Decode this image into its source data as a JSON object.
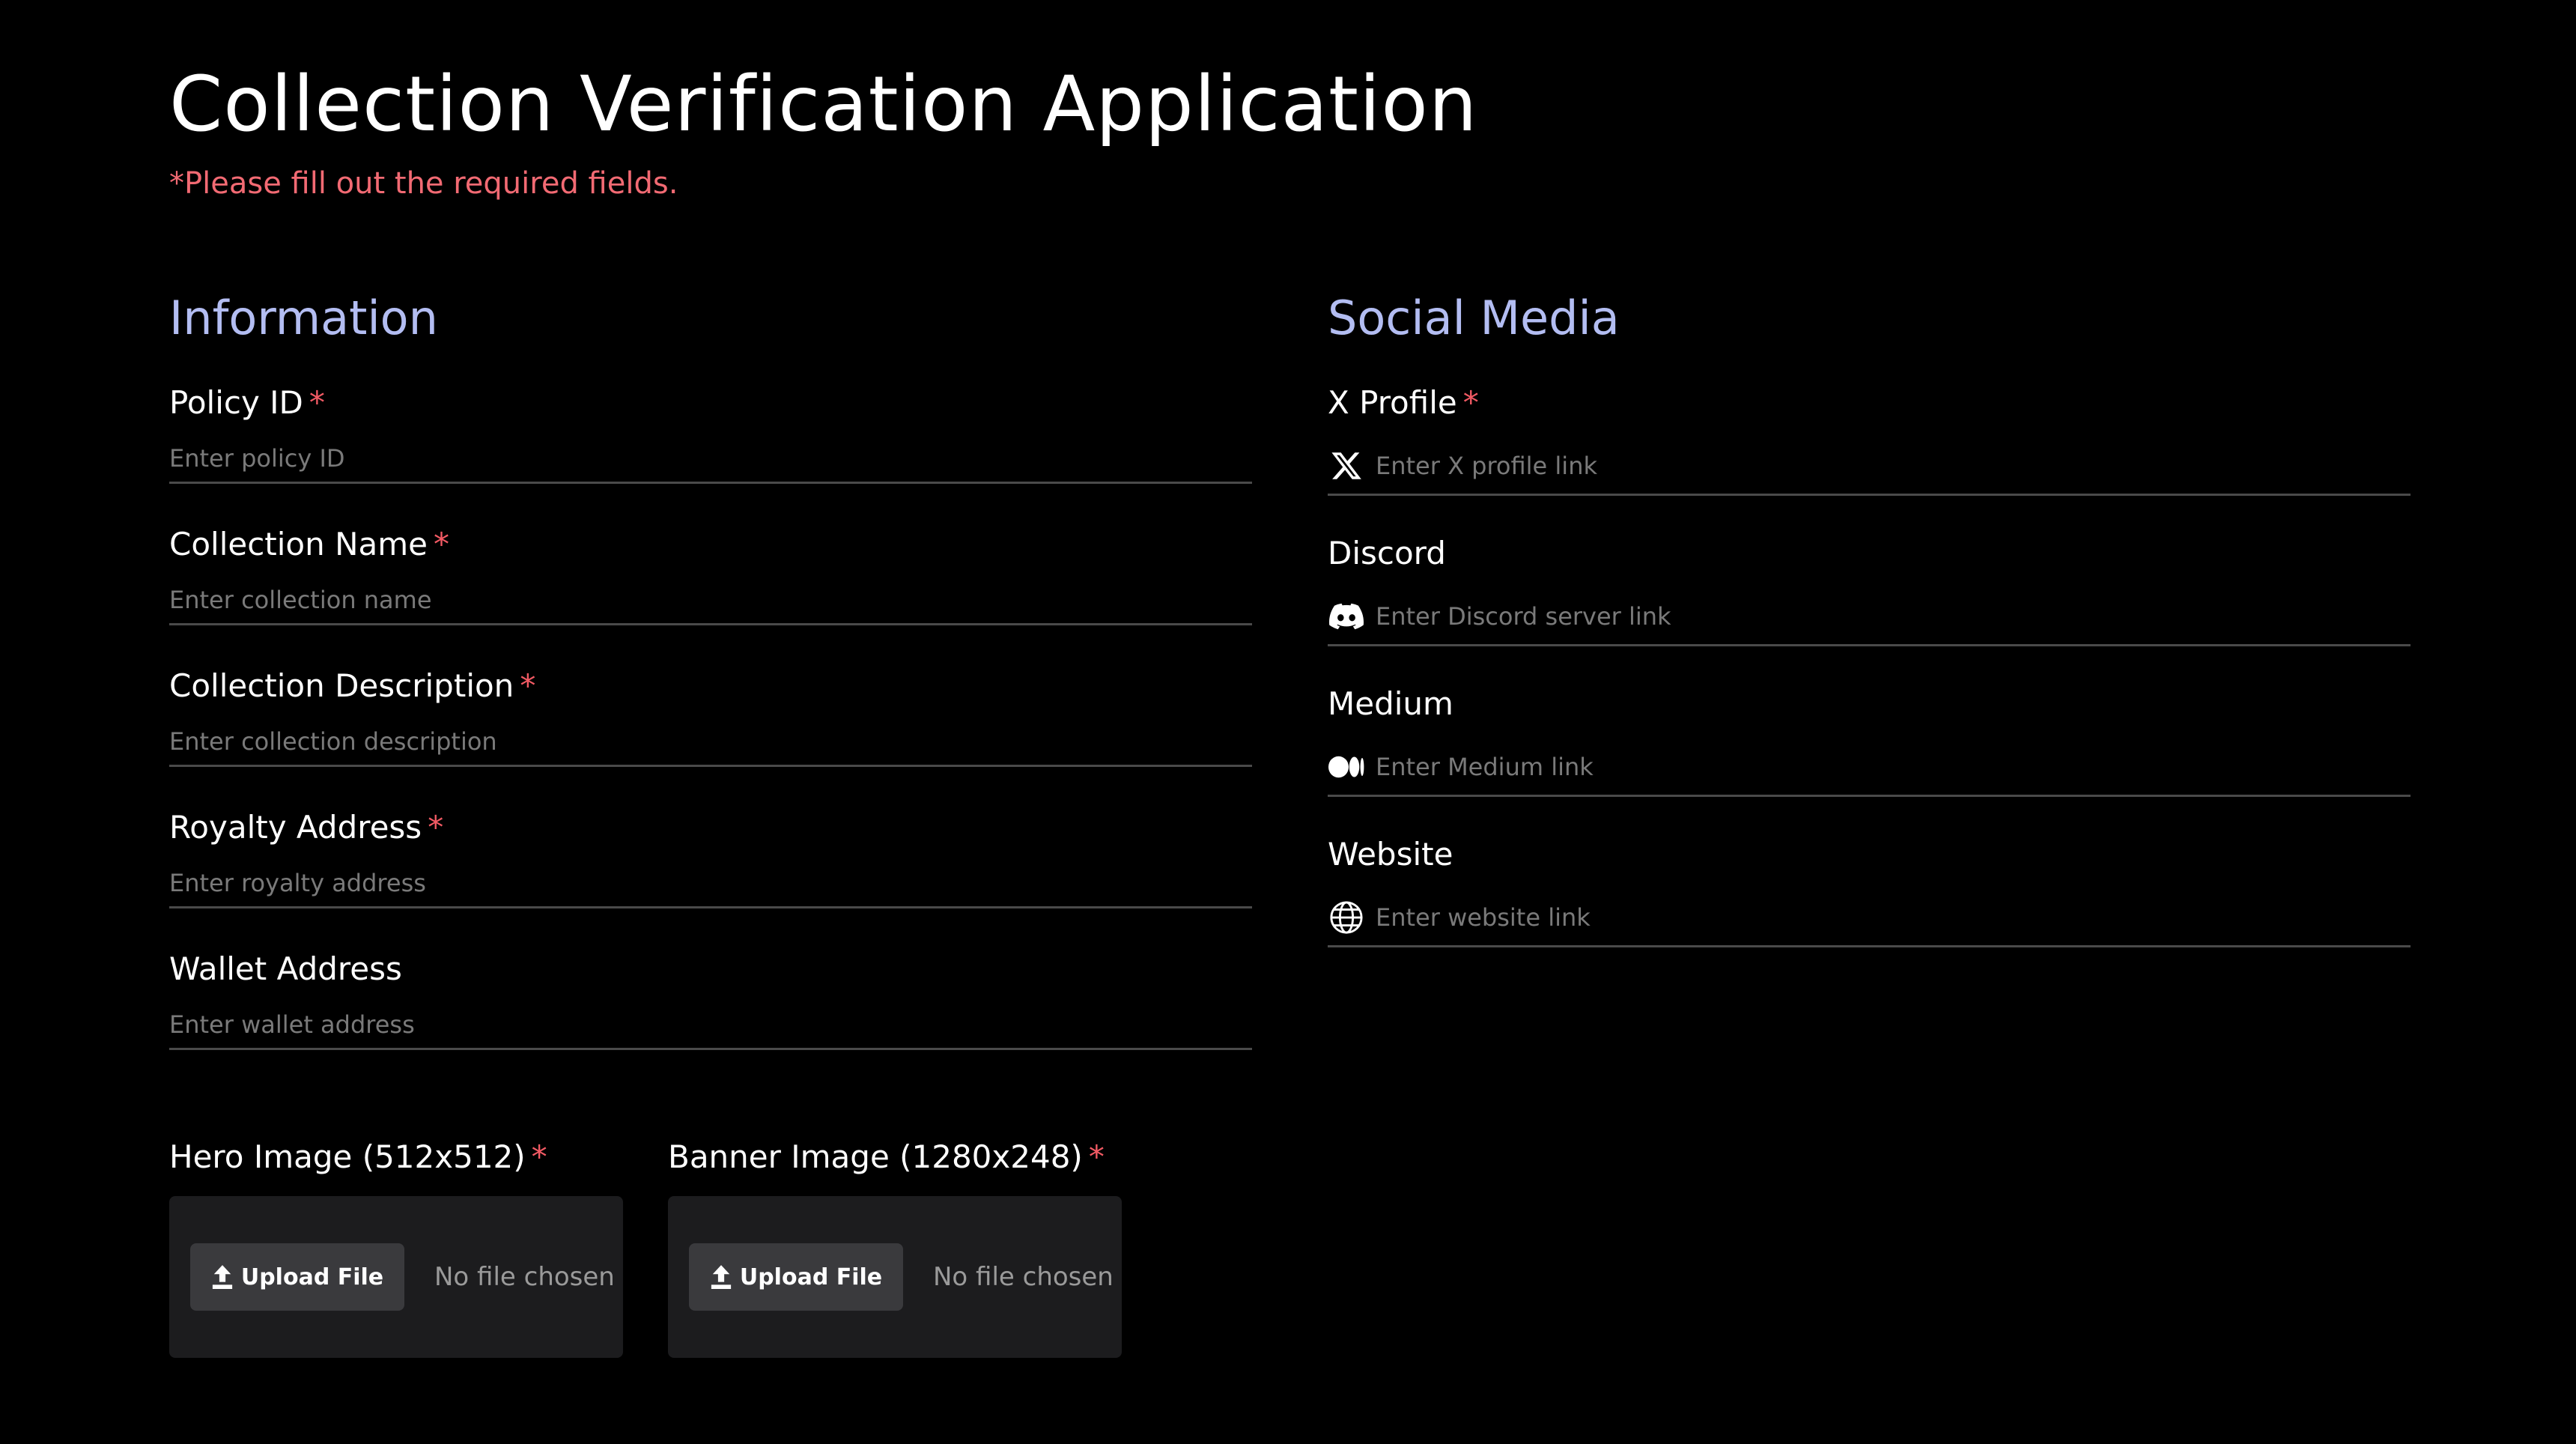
{
  "page": {
    "title": "Collection Verification Application",
    "required_note": "*Please fill out the required fields."
  },
  "information": {
    "heading": "Information",
    "fields": [
      {
        "label": "Policy ID",
        "required": "*",
        "placeholder": "Enter policy ID",
        "value": ""
      },
      {
        "label": "Collection Name",
        "required": "*",
        "placeholder": "Enter collection name",
        "value": ""
      },
      {
        "label": "Collection Description",
        "required": "*",
        "placeholder": "Enter collection description",
        "value": ""
      },
      {
        "label": "Royalty Address",
        "required": "*",
        "placeholder": "Enter royalty address",
        "value": ""
      },
      {
        "label": "Wallet Address",
        "required": "",
        "placeholder": "Enter wallet address",
        "value": ""
      }
    ]
  },
  "social": {
    "heading": "Social Media",
    "fields": [
      {
        "label": "X Profile",
        "required": "*",
        "placeholder": "Enter X profile link",
        "icon": "x-logo-icon",
        "value": ""
      },
      {
        "label": "Discord",
        "required": "",
        "placeholder": "Enter Discord server link",
        "icon": "discord-icon",
        "value": ""
      },
      {
        "label": "Medium",
        "required": "",
        "placeholder": "Enter Medium link",
        "icon": "medium-icon",
        "value": ""
      },
      {
        "label": "Website",
        "required": "",
        "placeholder": "Enter website link",
        "icon": "globe-icon",
        "value": ""
      }
    ]
  },
  "uploads": [
    {
      "label": "Hero Image (512x512)",
      "required": "*",
      "button_label": "Upload File",
      "status": "No file chosen",
      "icon": "upload-icon"
    },
    {
      "label": "Banner Image (1280x248)",
      "required": "*",
      "button_label": "Upload File",
      "status": "No file chosen",
      "icon": "upload-icon"
    }
  ],
  "colors": {
    "background": "#000000",
    "heading_accent": "#b3bdf2",
    "required": "#f25a64",
    "note": "#f26a73",
    "divider": "#4a4a4a",
    "upload_box": "#1c1c1e",
    "upload_button": "#3a3a3d"
  }
}
